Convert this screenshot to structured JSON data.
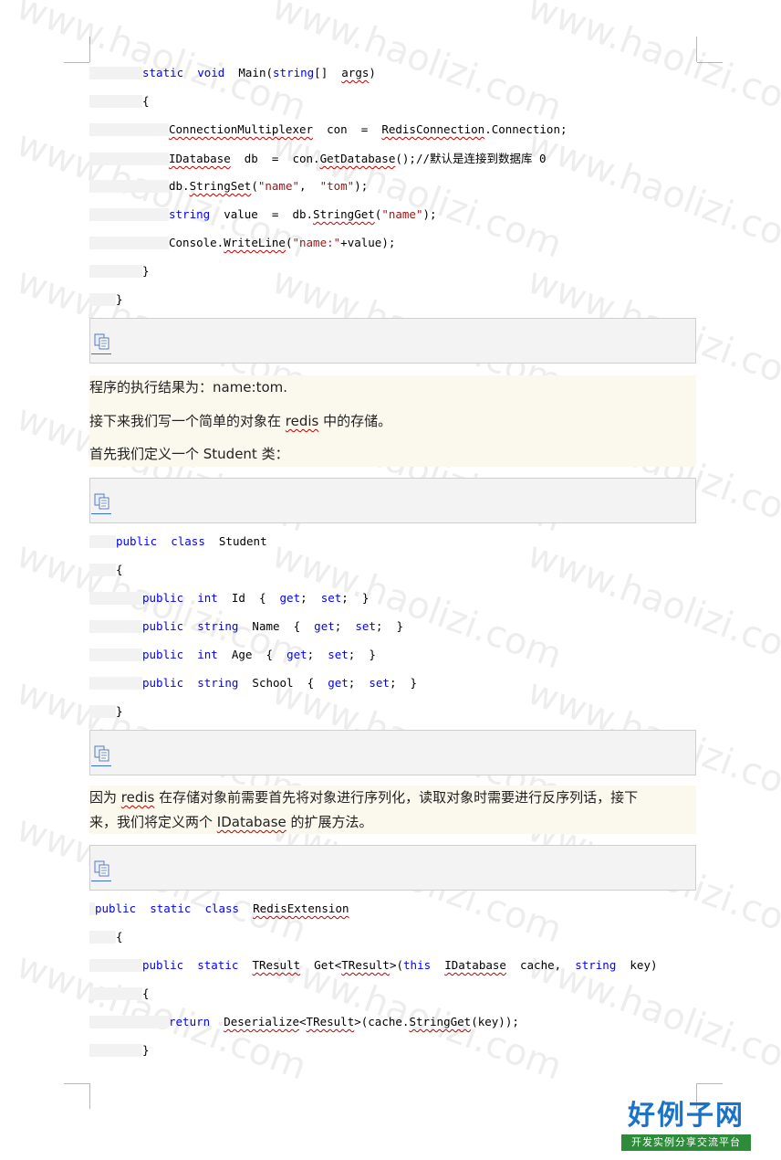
{
  "watermark_text": "www.haolizi.com",
  "code_main": [
    [
      [
        "kw",
        "static"
      ],
      [
        "",
        "  "
      ],
      [
        "kw",
        "void"
      ],
      [
        "",
        "  Main("
      ],
      [
        "kw",
        "string"
      ],
      [
        "",
        "[]  "
      ],
      [
        "sq",
        "args"
      ],
      [
        "",
        ")"
      ]
    ],
    [
      [
        "",
        "{"
      ]
    ],
    [
      [
        "sq",
        "ConnectionMultiplexer"
      ],
      [
        "",
        "  con  =  "
      ],
      [
        "sq",
        "RedisConnection"
      ],
      [
        "",
        ".Connection;"
      ]
    ],
    [
      [
        "sq",
        "IDatabase"
      ],
      [
        "",
        "  db  =  con."
      ],
      [
        "sq",
        "GetDatabase"
      ],
      [
        "",
        "();//默认是连接到数据库 0"
      ]
    ],
    [
      [
        "",
        "db."
      ],
      [
        "sq",
        "StringSet"
      ],
      [
        "",
        "("
      ],
      [
        "str",
        "\"name\""
      ],
      [
        "",
        ",  "
      ],
      [
        "str",
        "\"tom\""
      ],
      [
        "",
        ");"
      ]
    ],
    [
      [
        "kw",
        "string"
      ],
      [
        "",
        "  value  =  db."
      ],
      [
        "sq",
        "StringGet"
      ],
      [
        "",
        "("
      ],
      [
        "str",
        "\"name\""
      ],
      [
        "",
        ");"
      ]
    ],
    [
      [
        "",
        "Console."
      ],
      [
        "sq",
        "WriteLine"
      ],
      [
        "",
        "("
      ],
      [
        "str",
        "\"name:\""
      ],
      [
        "",
        "+value);"
      ]
    ],
    [
      [
        "",
        "}"
      ]
    ],
    [
      [
        "",
        "}"
      ]
    ]
  ],
  "paragraphs_1": [
    [
      [
        "",
        "程序的执行结果为：name:tom."
      ]
    ],
    [
      [
        "",
        "接下来我们写一个简单的对象在 "
      ],
      [
        "sq",
        "redis"
      ],
      [
        "",
        " 中的存储。"
      ]
    ],
    [
      [
        "",
        "首先我们定义一个 Student 类："
      ]
    ]
  ],
  "code_student": [
    [
      [
        "kw",
        "public"
      ],
      [
        "",
        "  "
      ],
      [
        "kw",
        "class"
      ],
      [
        "",
        "  Student"
      ]
    ],
    [
      [
        "",
        "{"
      ]
    ],
    [
      [
        "kw",
        "public"
      ],
      [
        "",
        "  "
      ],
      [
        "kw",
        "int"
      ],
      [
        "",
        "  Id  {  "
      ],
      [
        "kw",
        "get"
      ],
      [
        "",
        ";  "
      ],
      [
        "kw",
        "set"
      ],
      [
        "",
        ";  }"
      ]
    ],
    [
      [
        "kw",
        "public"
      ],
      [
        "",
        "  "
      ],
      [
        "kw",
        "string"
      ],
      [
        "",
        "  Name  {  "
      ],
      [
        "kw",
        "get"
      ],
      [
        "",
        ";  "
      ],
      [
        "kw",
        "set"
      ],
      [
        "",
        ";  }"
      ]
    ],
    [
      [
        "kw",
        "public"
      ],
      [
        "",
        "  "
      ],
      [
        "kw",
        "int"
      ],
      [
        "",
        "  Age  {  "
      ],
      [
        "kw",
        "get"
      ],
      [
        "",
        ";  "
      ],
      [
        "kw",
        "set"
      ],
      [
        "",
        ";  }"
      ]
    ],
    [
      [
        "kw",
        "public"
      ],
      [
        "",
        "  "
      ],
      [
        "kw",
        "string"
      ],
      [
        "",
        "  School  {  "
      ],
      [
        "kw",
        "get"
      ],
      [
        "",
        ";  "
      ],
      [
        "kw",
        "set"
      ],
      [
        "",
        ";  }"
      ]
    ],
    [
      [
        "",
        "}"
      ]
    ]
  ],
  "paragraphs_2": [
    [
      [
        "",
        "因为 "
      ],
      [
        "sq",
        "redis"
      ],
      [
        "",
        " 在存储对象前需要首先将对象进行序列化，读取对象时需要进行反序列话，接下"
      ]
    ],
    [
      [
        "",
        "来，我们将定义两个 "
      ],
      [
        "sq",
        "IDatabase"
      ],
      [
        "",
        " 的扩展方法。"
      ]
    ]
  ],
  "code_ext": [
    [
      [
        "kw",
        "public"
      ],
      [
        "",
        "  "
      ],
      [
        "kw",
        "static"
      ],
      [
        "",
        "  "
      ],
      [
        "kw",
        "class"
      ],
      [
        "",
        "  "
      ],
      [
        "sq",
        "RedisExtension"
      ]
    ],
    [
      [
        "",
        "{"
      ]
    ],
    [
      [
        "kw",
        "public"
      ],
      [
        "",
        "  "
      ],
      [
        "kw",
        "static"
      ],
      [
        "",
        "  "
      ],
      [
        "sq",
        "TResult"
      ],
      [
        "",
        "  Get<"
      ],
      [
        "sq",
        "TResult"
      ],
      [
        "",
        ">("
      ],
      [
        "kw",
        "this"
      ],
      [
        "",
        "  "
      ],
      [
        "sq",
        "IDatabase"
      ],
      [
        "",
        "  cache,  "
      ],
      [
        "kw",
        "string"
      ],
      [
        "",
        "  key)"
      ]
    ],
    [
      [
        "",
        "{"
      ]
    ],
    [
      [
        "kw",
        "return"
      ],
      [
        "",
        "  "
      ],
      [
        "sq",
        "Deserialize"
      ],
      [
        "",
        "<"
      ],
      [
        "sq",
        "TResult"
      ],
      [
        "",
        ">(cache."
      ],
      [
        "sq",
        "StringGet"
      ],
      [
        "",
        "(key));"
      ]
    ],
    [
      [
        "",
        "}"
      ]
    ]
  ],
  "logo": {
    "main": "好例子网",
    "sub": "开发实例分享交流平台"
  }
}
